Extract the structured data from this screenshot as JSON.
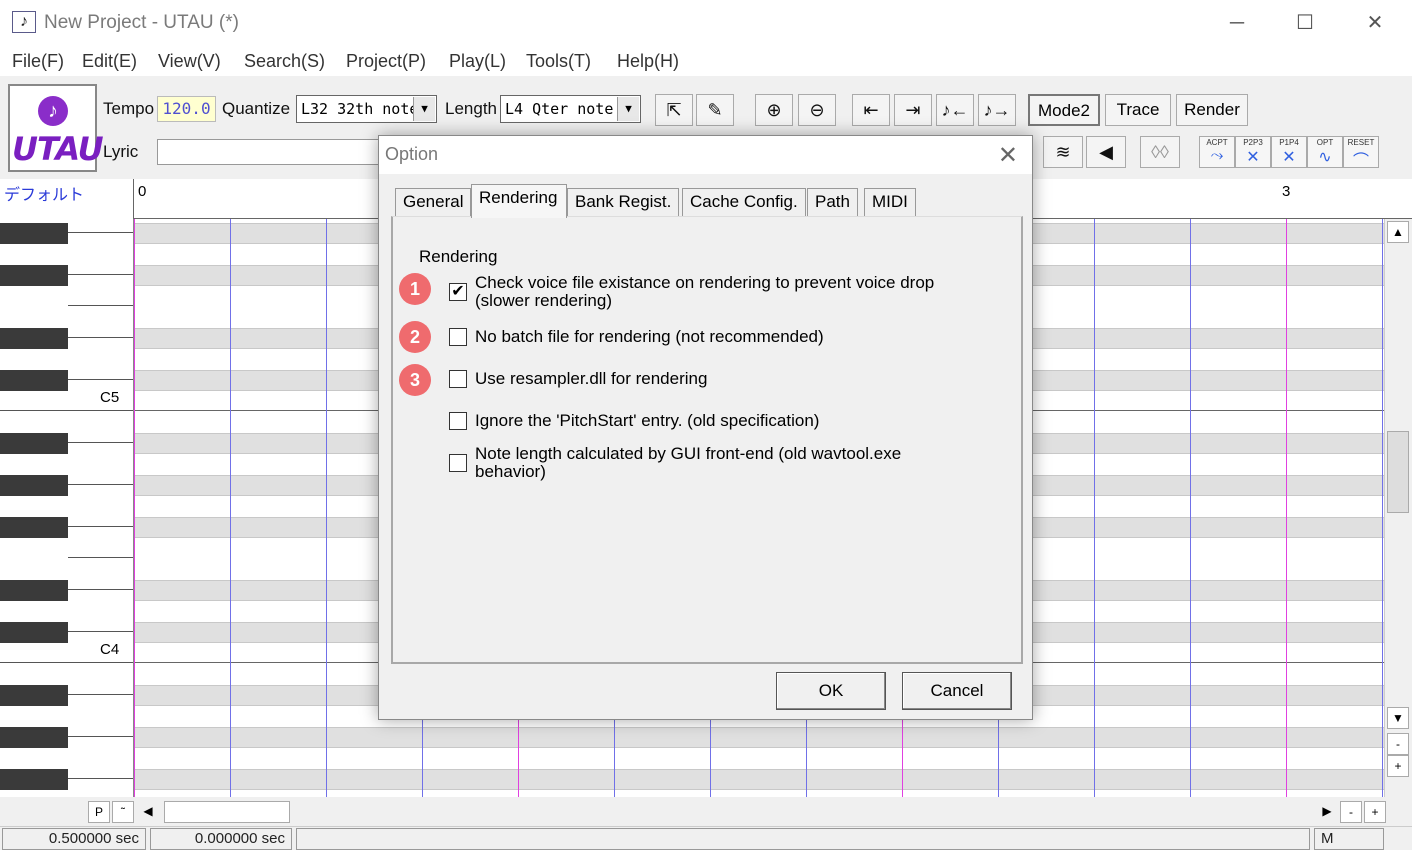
{
  "window": {
    "title": "New Project - UTAU (*)",
    "minimize": "─",
    "maximize": "☐",
    "close": "✕"
  },
  "menu": [
    "File(F)",
    "Edit(E)",
    "View(V)",
    "Search(S)",
    "Project(P)",
    "Play(L)",
    "Tools(T)",
    "Help(H)"
  ],
  "toolbar": {
    "logo_text": "UTAU",
    "tempo_label": "Tempo",
    "tempo_value": "120.0",
    "quantize_label": "Quantize",
    "quantize_value": "L32 32th note",
    "length_label": "Length",
    "length_value": "L4  Qter note",
    "lyric_label": "Lyric",
    "lyric_value": "",
    "mode2": "Mode2",
    "trace": "Trace",
    "render": "Render",
    "tool_buttons": [
      "ACPT",
      "P2P3",
      "P1P4",
      "OPT",
      "RESET"
    ]
  },
  "track": {
    "name": "デフォルト",
    "measures": [
      "0",
      "3"
    ]
  },
  "keys": {
    "c5": "C5",
    "c4": "C4"
  },
  "scroll": {
    "p": "P",
    "tilde": "˜",
    "minus": "-",
    "plus": "+"
  },
  "status": {
    "left": "0.500000 sec",
    "mid": "0.000000 sec",
    "mode": "M"
  },
  "dialog": {
    "title": "Option",
    "tabs": [
      "General",
      "Rendering",
      "Bank Regist.",
      "Cache Config.",
      "Path",
      "MIDI"
    ],
    "active_tab": "Rendering",
    "group_label": "Rendering",
    "options": [
      {
        "label": "Check voice file existance on rendering to prevent voice drop (slower rendering)",
        "checked": true,
        "badge": "1"
      },
      {
        "label": "No batch file for rendering (not recommended)",
        "checked": false,
        "badge": "2"
      },
      {
        "label": "Use resampler.dll for rendering",
        "checked": false,
        "badge": "3"
      },
      {
        "label": "Ignore the 'PitchStart' entry. (old specification)",
        "checked": false,
        "badge": ""
      },
      {
        "label": "Note length calculated by GUI front-end (old wavtool.exe behavior)",
        "checked": false,
        "badge": ""
      }
    ],
    "ok": "OK",
    "cancel": "Cancel"
  },
  "colors": {
    "accent_purple": "#7a1fc0",
    "grid_blue": "#7070e8",
    "grid_magenta": "#e040e0",
    "badge_red": "#ef6b6e",
    "tempo_bg": "#ffffd0"
  }
}
